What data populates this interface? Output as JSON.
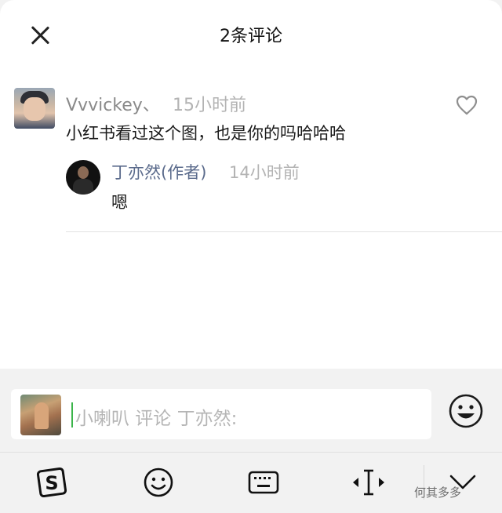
{
  "header": {
    "title": "2条评论"
  },
  "comment": {
    "user": "Vvvickey、",
    "time": "15小时前",
    "text": "小红书看过这个图，也是你的吗哈哈哈"
  },
  "reply": {
    "user": "丁亦然(作者)",
    "time": "14小时前",
    "text": "嗯"
  },
  "composer": {
    "placeholder": "小喇叭 评论 丁亦然:"
  },
  "keyboard_toolbar": {
    "icons": [
      "sogou-icon",
      "emoji-icon",
      "keyboard-icon",
      "cursor-move-icon",
      "collapse-icon"
    ]
  },
  "watermark": {
    "text": "何其多多"
  },
  "colors": {
    "accent_green": "#3bb44a",
    "author_blue": "#5b6b8c"
  }
}
